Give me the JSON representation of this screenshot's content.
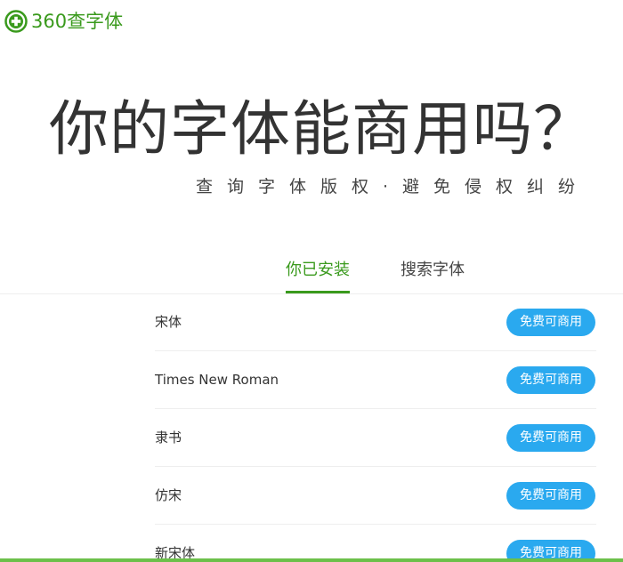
{
  "brand": {
    "name": "360查字体",
    "accent_color": "#3a9a1d",
    "logo_icon": "plus-circle-icon"
  },
  "hero": {
    "title": "你的字体能商用吗？",
    "subtitle": "查询字体版权·避免侵权纠纷"
  },
  "tabs": [
    {
      "label": "你已安装",
      "active": true
    },
    {
      "label": "搜索字体",
      "active": false
    }
  ],
  "fonts": [
    {
      "name": "宋体",
      "status": "免费可商用"
    },
    {
      "name": "Times New Roman",
      "status": "免费可商用"
    },
    {
      "name": "隶书",
      "status": "免费可商用"
    },
    {
      "name": "仿宋",
      "status": "免费可商用"
    },
    {
      "name": "新宋体",
      "status": "免费可商用"
    }
  ],
  "colors": {
    "status_button": "#2aa9ef",
    "bottom_bar": "#6cc04a"
  }
}
